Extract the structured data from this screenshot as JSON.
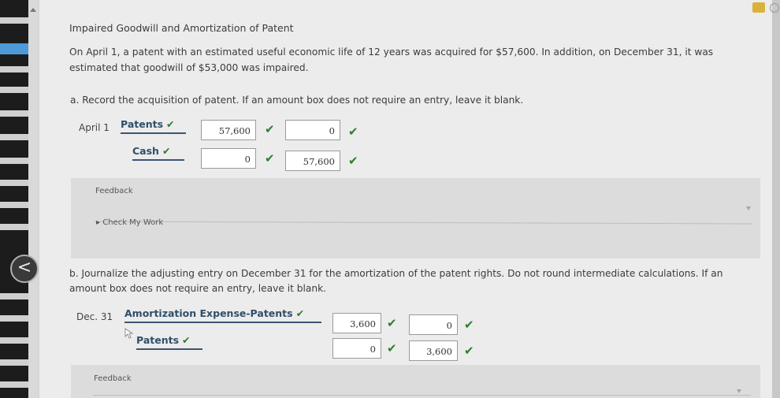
{
  "problem": {
    "title": "Impaired Goodwill and Amortization of Patent",
    "intro": "On April 1, a patent with an estimated useful economic life of 12 years was acquired for $57,600. In addition, on December 31, it was estimated that goodwill of $53,000 was impaired."
  },
  "part_a": {
    "instruction": "a. Record the acquisition of patent. If an amount box does not require an entry, leave it blank.",
    "date": "April 1",
    "rows": [
      {
        "account": "Patents",
        "debit": "57,600",
        "credit": "0"
      },
      {
        "account": "Cash",
        "debit": "0",
        "credit": "57,600"
      }
    ],
    "feedback_label": "Feedback",
    "check_my_work": "Check My Work"
  },
  "part_b": {
    "instruction": "b. Journalize the adjusting entry on December 31 for the amortization of the patent rights. Do not round intermediate calculations. If an amount box does not require an entry, leave it blank.",
    "date": "Dec. 31",
    "rows": [
      {
        "account": "Amortization Expense-Patents",
        "debit": "3,600",
        "credit": "0"
      },
      {
        "account": "Patents",
        "debit": "0",
        "credit": "3,600"
      }
    ],
    "feedback_label": "Feedback"
  },
  "symbols": {
    "check": "✔",
    "back": "<"
  },
  "colors": {
    "account_text": "#2f4f6a",
    "check_green": "#2e7d2e",
    "panel_bg": "#ececec",
    "feedback_bg": "#dcdcdc"
  }
}
